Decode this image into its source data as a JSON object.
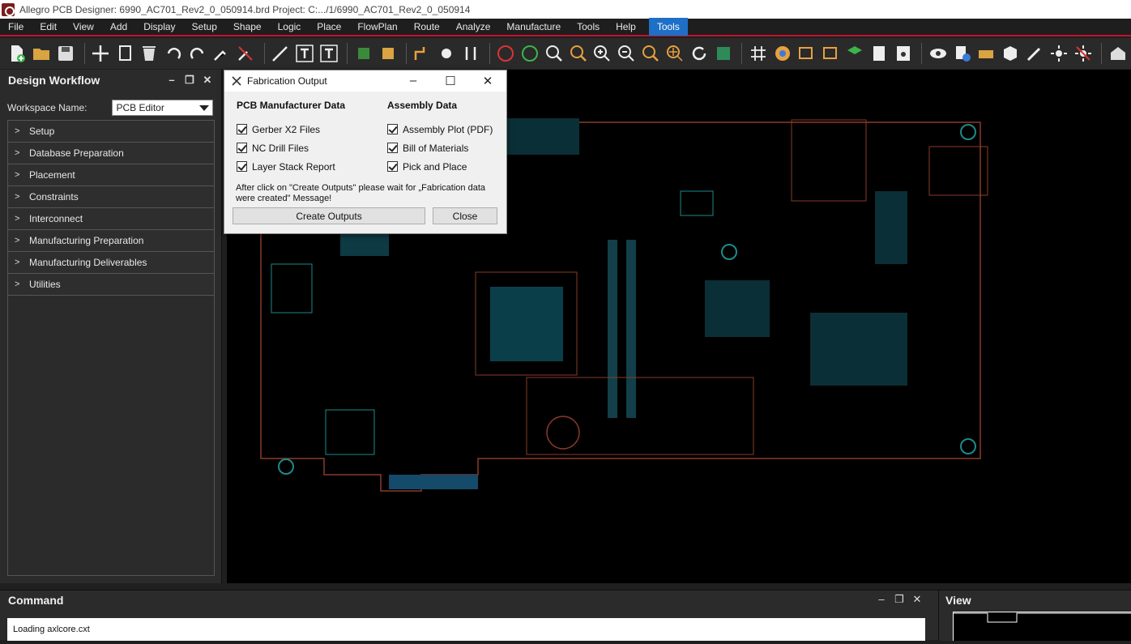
{
  "window": {
    "title": "Allegro PCB Designer: 6990_AC701_Rev2_0_050914.brd  Project: C:.../1/6990_AC701_Rev2_0_050914"
  },
  "menu": [
    "File",
    "Edit",
    "View",
    "Add",
    "Display",
    "Setup",
    "Shape",
    "Logic",
    "Place",
    "FlowPlan",
    "Route",
    "Analyze",
    "Manufacture",
    "Tools",
    "Help"
  ],
  "menu_active": "Tools",
  "left_panel": {
    "title": "Design Workflow",
    "workspace_label": "Workspace Name:",
    "workspace_value": "PCB Editor",
    "items": [
      "Setup",
      "Database Preparation",
      "Placement",
      "Constraints",
      "Interconnect",
      "Manufacturing Preparation",
      "Manufacturing Deliverables",
      "Utilities"
    ]
  },
  "dialog": {
    "title": "Fabrication Output",
    "col1_title": "PCB Manufacturer Data",
    "col1_items": [
      "Gerber X2 Files",
      "NC Drill Files",
      "Layer Stack Report"
    ],
    "col2_title": "Assembly Data",
    "col2_items": [
      "Assembly Plot (PDF)",
      "Bill of Materials",
      "Pick and Place"
    ],
    "note": "After click on \"Create Outputs\" please wait for „Fabrication data were created\" Message!",
    "create_label": "Create Outputs",
    "close_label": "Close"
  },
  "command": {
    "title": "Command",
    "line": "Loading axlcore.cxt"
  },
  "view": {
    "title": "View"
  },
  "colors": {
    "accent": "#c8102e",
    "menu_active": "#1e6fc8",
    "board_outline": "#9a3a2a",
    "board_copper": "#1d8a8a"
  }
}
